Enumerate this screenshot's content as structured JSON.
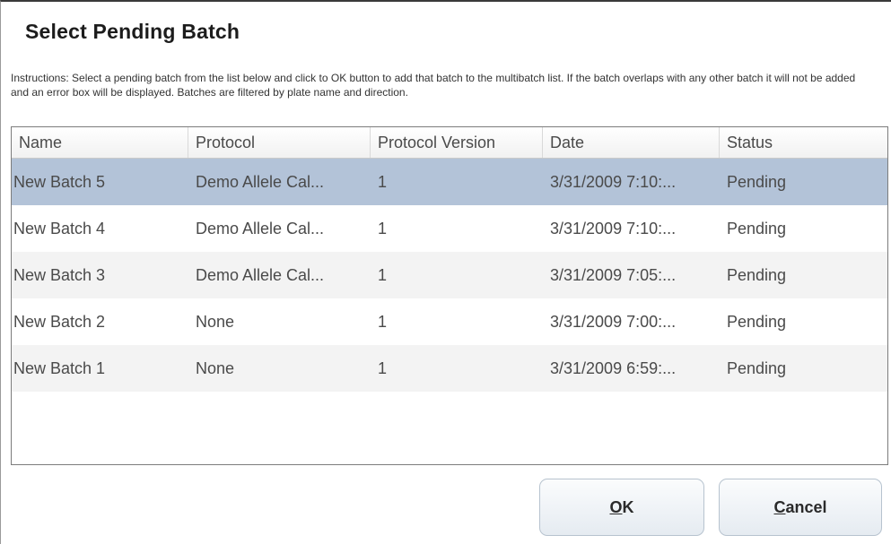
{
  "dialog": {
    "title": "Select Pending Batch",
    "instructions": "Instructions: Select a pending batch from the list below and click to OK button to add that batch to the multibatch list. If the batch overlaps with any other batch it will not be added and an error box will be displayed. Batches are filtered by plate name and direction."
  },
  "table": {
    "columns": [
      "Name",
      "Protocol",
      "Protocol Version",
      "Date",
      "Status"
    ],
    "rows": [
      {
        "name": "New Batch 5",
        "protocol": "Demo Allele Cal...",
        "version": "1",
        "date": "3/31/2009 7:10:...",
        "status": "Pending"
      },
      {
        "name": "New Batch 4",
        "protocol": "Demo Allele Cal...",
        "version": "1",
        "date": "3/31/2009 7:10:...",
        "status": "Pending"
      },
      {
        "name": "New Batch 3",
        "protocol": "Demo Allele Cal...",
        "version": "1",
        "date": "3/31/2009 7:05:...",
        "status": "Pending"
      },
      {
        "name": "New Batch 2",
        "protocol": "None",
        "version": "1",
        "date": "3/31/2009 7:00:...",
        "status": "Pending"
      },
      {
        "name": "New Batch 1",
        "protocol": "None",
        "version": "1",
        "date": "3/31/2009 6:59:...",
        "status": "Pending"
      }
    ],
    "selected_row": 0
  },
  "buttons": {
    "ok_mnemonic": "O",
    "ok_rest": "K",
    "cancel_mnemonic": "C",
    "cancel_rest": "ancel"
  },
  "colors": {
    "selected_row": "#b3c3d8",
    "alt_row": "#f3f3f3",
    "button_border": "#b7c3cf"
  }
}
